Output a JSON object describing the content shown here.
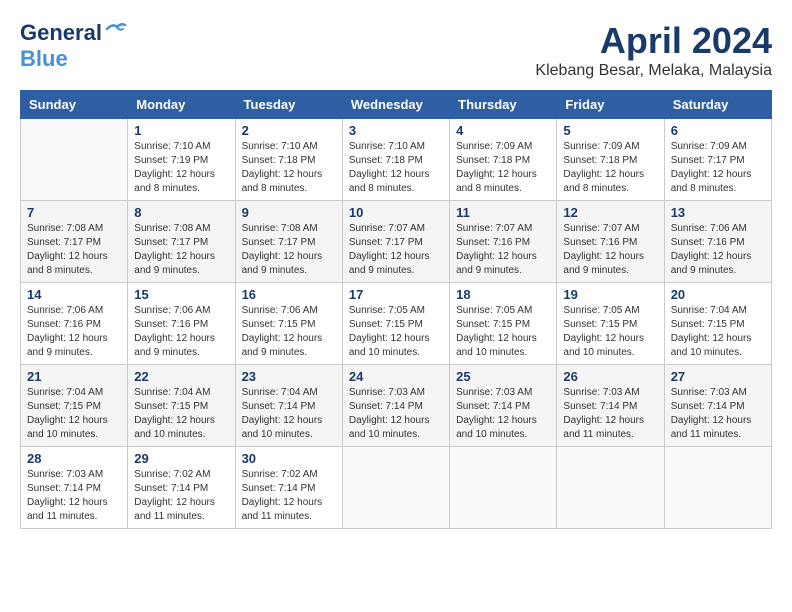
{
  "header": {
    "logo": {
      "general": "General",
      "blue": "Blue"
    },
    "title": "April 2024",
    "subtitle": "Klebang Besar, Melaka, Malaysia"
  },
  "weekdays": [
    "Sunday",
    "Monday",
    "Tuesday",
    "Wednesday",
    "Thursday",
    "Friday",
    "Saturday"
  ],
  "weeks": [
    [
      {
        "day": "",
        "sunrise": "",
        "sunset": "",
        "daylight": ""
      },
      {
        "day": "1",
        "sunrise": "Sunrise: 7:10 AM",
        "sunset": "Sunset: 7:19 PM",
        "daylight": "Daylight: 12 hours and 8 minutes."
      },
      {
        "day": "2",
        "sunrise": "Sunrise: 7:10 AM",
        "sunset": "Sunset: 7:18 PM",
        "daylight": "Daylight: 12 hours and 8 minutes."
      },
      {
        "day": "3",
        "sunrise": "Sunrise: 7:10 AM",
        "sunset": "Sunset: 7:18 PM",
        "daylight": "Daylight: 12 hours and 8 minutes."
      },
      {
        "day": "4",
        "sunrise": "Sunrise: 7:09 AM",
        "sunset": "Sunset: 7:18 PM",
        "daylight": "Daylight: 12 hours and 8 minutes."
      },
      {
        "day": "5",
        "sunrise": "Sunrise: 7:09 AM",
        "sunset": "Sunset: 7:18 PM",
        "daylight": "Daylight: 12 hours and 8 minutes."
      },
      {
        "day": "6",
        "sunrise": "Sunrise: 7:09 AM",
        "sunset": "Sunset: 7:17 PM",
        "daylight": "Daylight: 12 hours and 8 minutes."
      }
    ],
    [
      {
        "day": "7",
        "sunrise": "Sunrise: 7:08 AM",
        "sunset": "Sunset: 7:17 PM",
        "daylight": "Daylight: 12 hours and 8 minutes."
      },
      {
        "day": "8",
        "sunrise": "Sunrise: 7:08 AM",
        "sunset": "Sunset: 7:17 PM",
        "daylight": "Daylight: 12 hours and 9 minutes."
      },
      {
        "day": "9",
        "sunrise": "Sunrise: 7:08 AM",
        "sunset": "Sunset: 7:17 PM",
        "daylight": "Daylight: 12 hours and 9 minutes."
      },
      {
        "day": "10",
        "sunrise": "Sunrise: 7:07 AM",
        "sunset": "Sunset: 7:17 PM",
        "daylight": "Daylight: 12 hours and 9 minutes."
      },
      {
        "day": "11",
        "sunrise": "Sunrise: 7:07 AM",
        "sunset": "Sunset: 7:16 PM",
        "daylight": "Daylight: 12 hours and 9 minutes."
      },
      {
        "day": "12",
        "sunrise": "Sunrise: 7:07 AM",
        "sunset": "Sunset: 7:16 PM",
        "daylight": "Daylight: 12 hours and 9 minutes."
      },
      {
        "day": "13",
        "sunrise": "Sunrise: 7:06 AM",
        "sunset": "Sunset: 7:16 PM",
        "daylight": "Daylight: 12 hours and 9 minutes."
      }
    ],
    [
      {
        "day": "14",
        "sunrise": "Sunrise: 7:06 AM",
        "sunset": "Sunset: 7:16 PM",
        "daylight": "Daylight: 12 hours and 9 minutes."
      },
      {
        "day": "15",
        "sunrise": "Sunrise: 7:06 AM",
        "sunset": "Sunset: 7:16 PM",
        "daylight": "Daylight: 12 hours and 9 minutes."
      },
      {
        "day": "16",
        "sunrise": "Sunrise: 7:06 AM",
        "sunset": "Sunset: 7:15 PM",
        "daylight": "Daylight: 12 hours and 9 minutes."
      },
      {
        "day": "17",
        "sunrise": "Sunrise: 7:05 AM",
        "sunset": "Sunset: 7:15 PM",
        "daylight": "Daylight: 12 hours and 10 minutes."
      },
      {
        "day": "18",
        "sunrise": "Sunrise: 7:05 AM",
        "sunset": "Sunset: 7:15 PM",
        "daylight": "Daylight: 12 hours and 10 minutes."
      },
      {
        "day": "19",
        "sunrise": "Sunrise: 7:05 AM",
        "sunset": "Sunset: 7:15 PM",
        "daylight": "Daylight: 12 hours and 10 minutes."
      },
      {
        "day": "20",
        "sunrise": "Sunrise: 7:04 AM",
        "sunset": "Sunset: 7:15 PM",
        "daylight": "Daylight: 12 hours and 10 minutes."
      }
    ],
    [
      {
        "day": "21",
        "sunrise": "Sunrise: 7:04 AM",
        "sunset": "Sunset: 7:15 PM",
        "daylight": "Daylight: 12 hours and 10 minutes."
      },
      {
        "day": "22",
        "sunrise": "Sunrise: 7:04 AM",
        "sunset": "Sunset: 7:15 PM",
        "daylight": "Daylight: 12 hours and 10 minutes."
      },
      {
        "day": "23",
        "sunrise": "Sunrise: 7:04 AM",
        "sunset": "Sunset: 7:14 PM",
        "daylight": "Daylight: 12 hours and 10 minutes."
      },
      {
        "day": "24",
        "sunrise": "Sunrise: 7:03 AM",
        "sunset": "Sunset: 7:14 PM",
        "daylight": "Daylight: 12 hours and 10 minutes."
      },
      {
        "day": "25",
        "sunrise": "Sunrise: 7:03 AM",
        "sunset": "Sunset: 7:14 PM",
        "daylight": "Daylight: 12 hours and 10 minutes."
      },
      {
        "day": "26",
        "sunrise": "Sunrise: 7:03 AM",
        "sunset": "Sunset: 7:14 PM",
        "daylight": "Daylight: 12 hours and 11 minutes."
      },
      {
        "day": "27",
        "sunrise": "Sunrise: 7:03 AM",
        "sunset": "Sunset: 7:14 PM",
        "daylight": "Daylight: 12 hours and 11 minutes."
      }
    ],
    [
      {
        "day": "28",
        "sunrise": "Sunrise: 7:03 AM",
        "sunset": "Sunset: 7:14 PM",
        "daylight": "Daylight: 12 hours and 11 minutes."
      },
      {
        "day": "29",
        "sunrise": "Sunrise: 7:02 AM",
        "sunset": "Sunset: 7:14 PM",
        "daylight": "Daylight: 12 hours and 11 minutes."
      },
      {
        "day": "30",
        "sunrise": "Sunrise: 7:02 AM",
        "sunset": "Sunset: 7:14 PM",
        "daylight": "Daylight: 12 hours and 11 minutes."
      },
      {
        "day": "",
        "sunrise": "",
        "sunset": "",
        "daylight": ""
      },
      {
        "day": "",
        "sunrise": "",
        "sunset": "",
        "daylight": ""
      },
      {
        "day": "",
        "sunrise": "",
        "sunset": "",
        "daylight": ""
      },
      {
        "day": "",
        "sunrise": "",
        "sunset": "",
        "daylight": ""
      }
    ]
  ]
}
